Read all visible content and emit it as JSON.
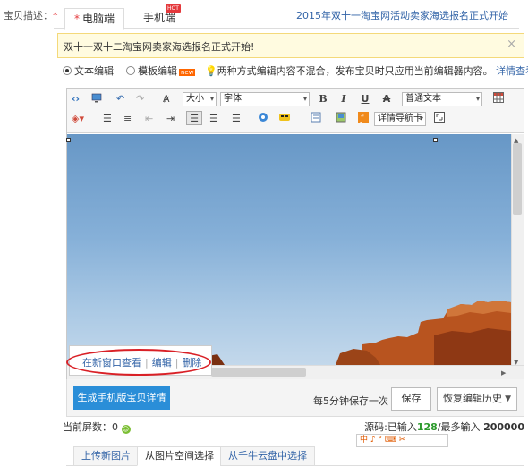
{
  "description_label": "宝贝描述",
  "required_mark": "*",
  "tabs": [
    {
      "label": "电脑端",
      "active": true
    },
    {
      "label": "手机端",
      "active": false,
      "badge": "HOT"
    }
  ],
  "promo_link": "2015年双十一淘宝网活动卖家海选报名正式开始",
  "notice": {
    "text": "双十一双十二淘宝网卖家海选报名正式开始!",
    "close": "×"
  },
  "edit_modes": {
    "text_mode": "文本编辑",
    "template_mode": "模板编辑",
    "template_badge": "new",
    "tip": "两种方式编辑内容不混合，发布宝贝时只应用当前编辑器内容。",
    "tip_link": "详情查看"
  },
  "toolbar": {
    "size_select": "大小",
    "font_select": "字体",
    "bold": "B",
    "italic": "I",
    "underline": "U",
    "strike": "A",
    "format_select": "普通文本",
    "detail_nav_select": "详情导航卡"
  },
  "image_popup": {
    "open_new_window": "在新窗口查看",
    "edit": "编辑",
    "delete": "删除",
    "separator": "|"
  },
  "bottom_bar": {
    "generate_mobile": "生成手机版宝贝详情",
    "autosave_note": "每5分钟保存一次",
    "save": "保存",
    "restore_history": "恢复编辑历史"
  },
  "status": {
    "screens_label": "当前屏数：",
    "screens_value": "0",
    "source_label": "源码:已输入",
    "source_count": "128",
    "source_sep": "/最多输入",
    "source_max": "200000"
  },
  "ime_toolbar": "中 ♪ ° ⌨ ✂",
  "image_tabs": [
    {
      "label": "上传新图片",
      "active": false
    },
    {
      "label": "从图片空间选择",
      "active": true
    },
    {
      "label": "从千牛云盘中选择",
      "active": false
    }
  ],
  "colors": {
    "accent_blue": "#2a8ed8",
    "link_blue": "#3465a8",
    "required_red": "#e4393c",
    "highlight_oval": "#d92026"
  }
}
